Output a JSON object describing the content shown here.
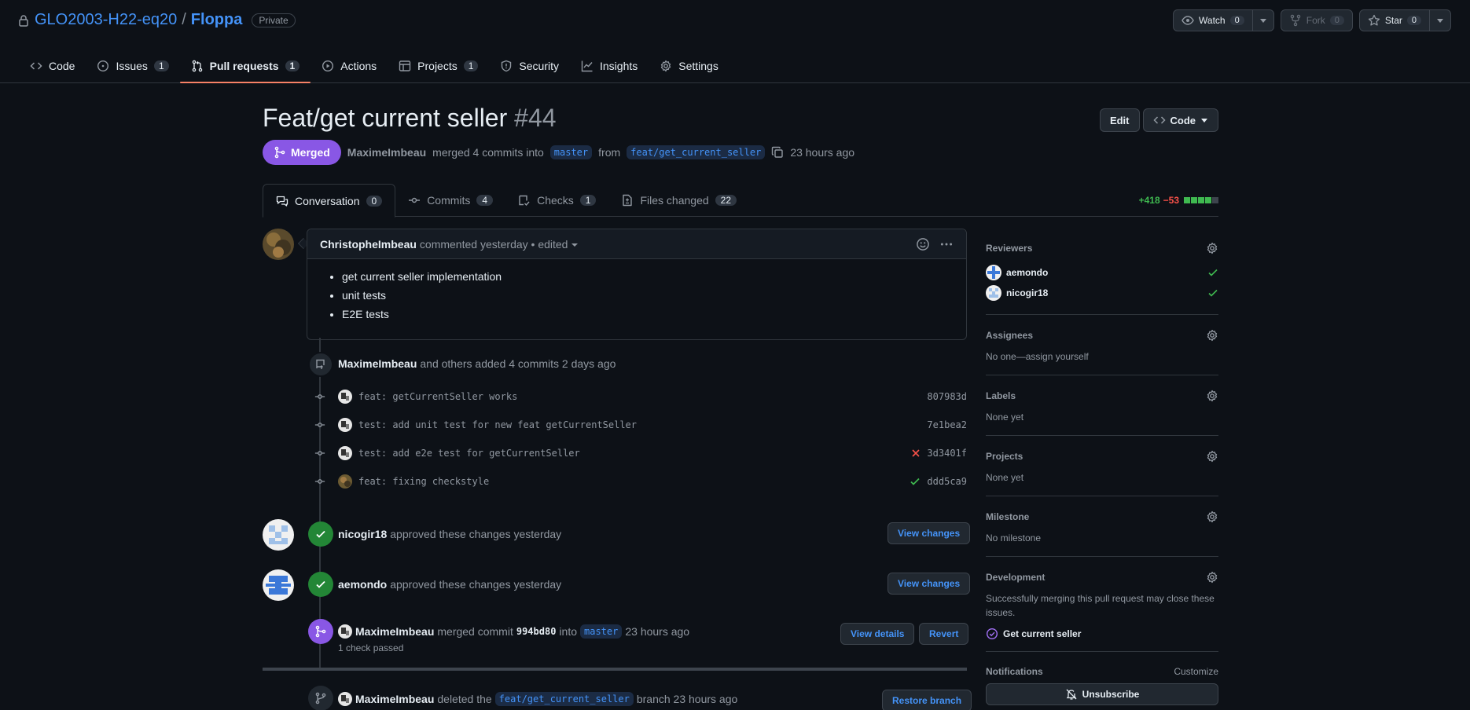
{
  "repo": {
    "owner": "GLO2003-H22-eq20",
    "separator": "/",
    "name": "Floppa",
    "visibility": "Private"
  },
  "head_actions": {
    "watch_label": "Watch",
    "watch_count": "0",
    "fork_label": "Fork",
    "fork_count": "0",
    "star_label": "Star",
    "star_count": "0"
  },
  "nav": [
    {
      "label": "Code",
      "count": ""
    },
    {
      "label": "Issues",
      "count": "1"
    },
    {
      "label": "Pull requests",
      "count": "1"
    },
    {
      "label": "Actions",
      "count": ""
    },
    {
      "label": "Projects",
      "count": "1"
    },
    {
      "label": "Security",
      "count": ""
    },
    {
      "label": "Insights",
      "count": ""
    },
    {
      "label": "Settings",
      "count": ""
    }
  ],
  "pr": {
    "title": "Feat/get current seller",
    "number": "#44",
    "edit_label": "Edit",
    "code_label": "Code",
    "state": "Merged",
    "author": "MaximeImbeau",
    "merge_text": "merged 4 commits into",
    "base_branch": "master",
    "from_text": "from",
    "head_branch": "feat/get_current_seller",
    "time": "23 hours ago"
  },
  "tabs": [
    {
      "label": "Conversation",
      "count": "0"
    },
    {
      "label": "Commits",
      "count": "4"
    },
    {
      "label": "Checks",
      "count": "1"
    },
    {
      "label": "Files changed",
      "count": "22"
    }
  ],
  "diffstat": {
    "additions": "+418",
    "deletions": "−53",
    "added_blocks": 4,
    "total_blocks": 5
  },
  "comment": {
    "author": "ChristopheImbeau",
    "meta": "commented yesterday • edited",
    "items": [
      "get current seller implementation",
      "unit tests",
      "E2E tests"
    ]
  },
  "commits_event": {
    "author": "MaximeImbeau",
    "text": "and others added 4 commits 2 days ago"
  },
  "commits": [
    {
      "message": "feat: getCurrentSeller works",
      "sha": "807983d",
      "status": ""
    },
    {
      "message": "test: add unit test for new feat getCurrentSeller",
      "sha": "7e1bea2",
      "status": ""
    },
    {
      "message": "test: add e2e test for getCurrentSeller",
      "sha": "3d3401f",
      "status": "fail"
    },
    {
      "message": "feat: fixing checkstyle",
      "sha": "ddd5ca9",
      "status": "pass"
    }
  ],
  "reviews": [
    {
      "author": "nicogir18",
      "text": "approved these changes yesterday",
      "button": "View changes"
    },
    {
      "author": "aemondo",
      "text": "approved these changes yesterday",
      "button": "View changes"
    }
  ],
  "merge_event": {
    "author": "MaximeImbeau",
    "text1": "merged commit",
    "sha": "994bd80",
    "text2": "into",
    "branch": "master",
    "time": "23 hours ago",
    "checks": "1 check passed",
    "details_label": "View details",
    "revert_label": "Revert"
  },
  "delete_event": {
    "author": "MaximeImbeau",
    "text1": "deleted the",
    "branch": "feat/get_current_seller",
    "text2": "branch 23 hours ago",
    "restore_label": "Restore branch"
  },
  "sidebar": {
    "reviewers_title": "Reviewers",
    "reviewers": [
      "aemondo",
      "nicogir18"
    ],
    "assignees_title": "Assignees",
    "assignees_text": "No one—assign yourself",
    "labels_title": "Labels",
    "labels_text": "None yet",
    "projects_title": "Projects",
    "projects_text": "None yet",
    "milestone_title": "Milestone",
    "milestone_text": "No milestone",
    "development_title": "Development",
    "development_text": "Successfully merging this pull request may close these issues.",
    "linked_issue": "Get current seller",
    "notifications_title": "Notifications",
    "customize_label": "Customize",
    "unsubscribe_label": "Unsubscribe"
  },
  "colors": {
    "background": "#0d1117",
    "link": "#4493f8",
    "merged": "#8957e5",
    "success": "#238636",
    "danger": "#f85149",
    "active_tab_underline": "#f78166"
  }
}
